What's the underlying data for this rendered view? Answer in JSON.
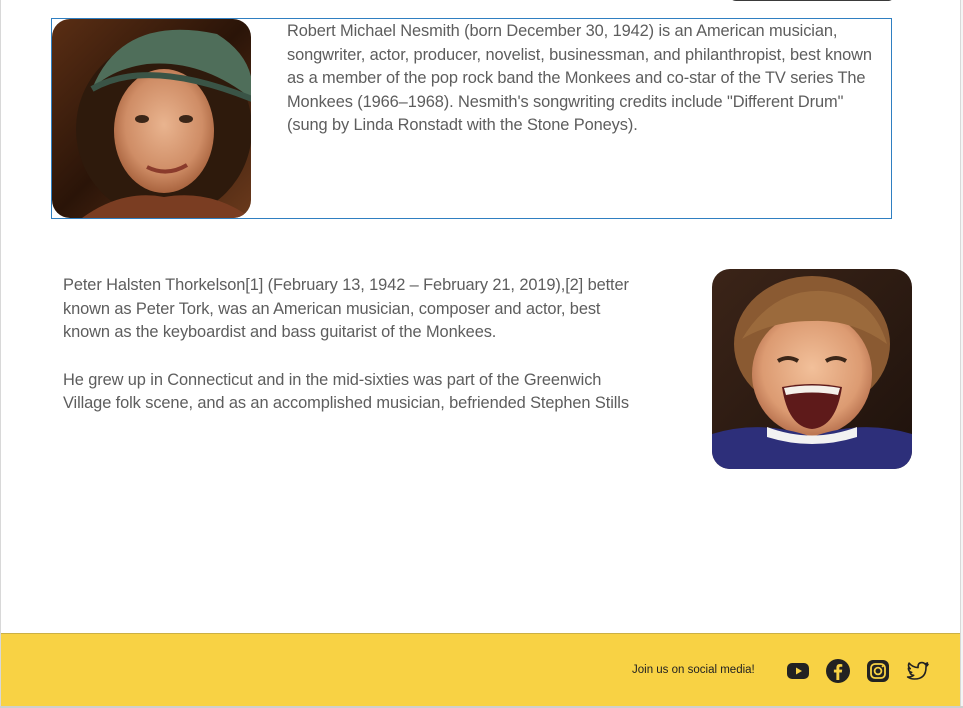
{
  "bio_1": {
    "photo_alt": "Michael Nesmith portrait",
    "text": "Robert Michael Nesmith (born December 30, 1942) is an American musician, songwriter, actor, producer, novelist, businessman, and philanthropist, best known as a member of the pop rock band the Monkees and co-star of the TV series The Monkees (1966–1968). Nesmith's songwriting credits include \"Different Drum\" (sung by Linda Ronstadt with the Stone Poneys)."
  },
  "bio_2": {
    "photo_alt": "Peter Tork portrait",
    "paragraph_1": "Peter Halsten Thorkelson[1] (February 13, 1942 – February 21, 2019),[2] better known as Peter Tork, was an American musician, composer and actor, best known as the keyboardist and bass guitarist of the Monkees.",
    "paragraph_2": "He grew up in Connecticut and in the mid-sixties was part of the Greenwich Village folk scene, and as an accomplished musician, befriended Stephen Stills"
  },
  "footer": {
    "social_text": "Join us on social media!",
    "icons": [
      "youtube-icon",
      "facebook-icon",
      "instagram-icon",
      "twitter-icon"
    ],
    "background_color": "#f8d244",
    "icon_color": "#222222"
  },
  "colors": {
    "text": "#5d5d5d",
    "box_border": "#2f7fc1"
  }
}
